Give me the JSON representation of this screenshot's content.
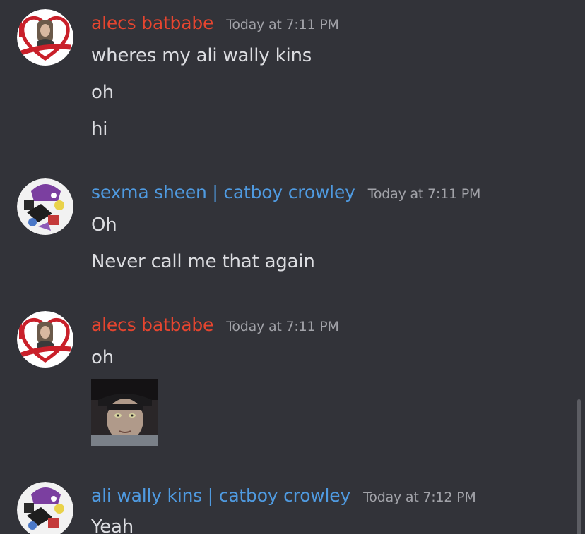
{
  "colors": {
    "background": "#323339",
    "author_red": "#e6452f",
    "author_blue": "#4f9ae0",
    "timestamp": "#a2a3a9",
    "message_text": "#dcdde1"
  },
  "messages": [
    {
      "author": "alecs batbabe",
      "timestamp": "Today at 7:11 PM",
      "avatar_icon": "heart-avatar-icon",
      "lines": [
        "wheres my ali wally kins",
        "oh",
        "hi"
      ]
    },
    {
      "author": "sexma sheen | catboy crowley",
      "timestamp": "Today at 7:11 PM",
      "avatar_icon": "collage-avatar-icon",
      "lines": [
        "Oh",
        "Never call me that again"
      ]
    },
    {
      "author": "alecs batbabe",
      "timestamp": "Today at 7:11 PM",
      "avatar_icon": "heart-avatar-icon",
      "lines": [
        "oh"
      ],
      "attachment_icon": "photo-attachment-icon"
    },
    {
      "author": "ali wally kins | catboy crowley",
      "timestamp": "Today at 7:12 PM",
      "avatar_icon": "collage-avatar-icon",
      "lines": [
        "Yeah"
      ]
    }
  ]
}
